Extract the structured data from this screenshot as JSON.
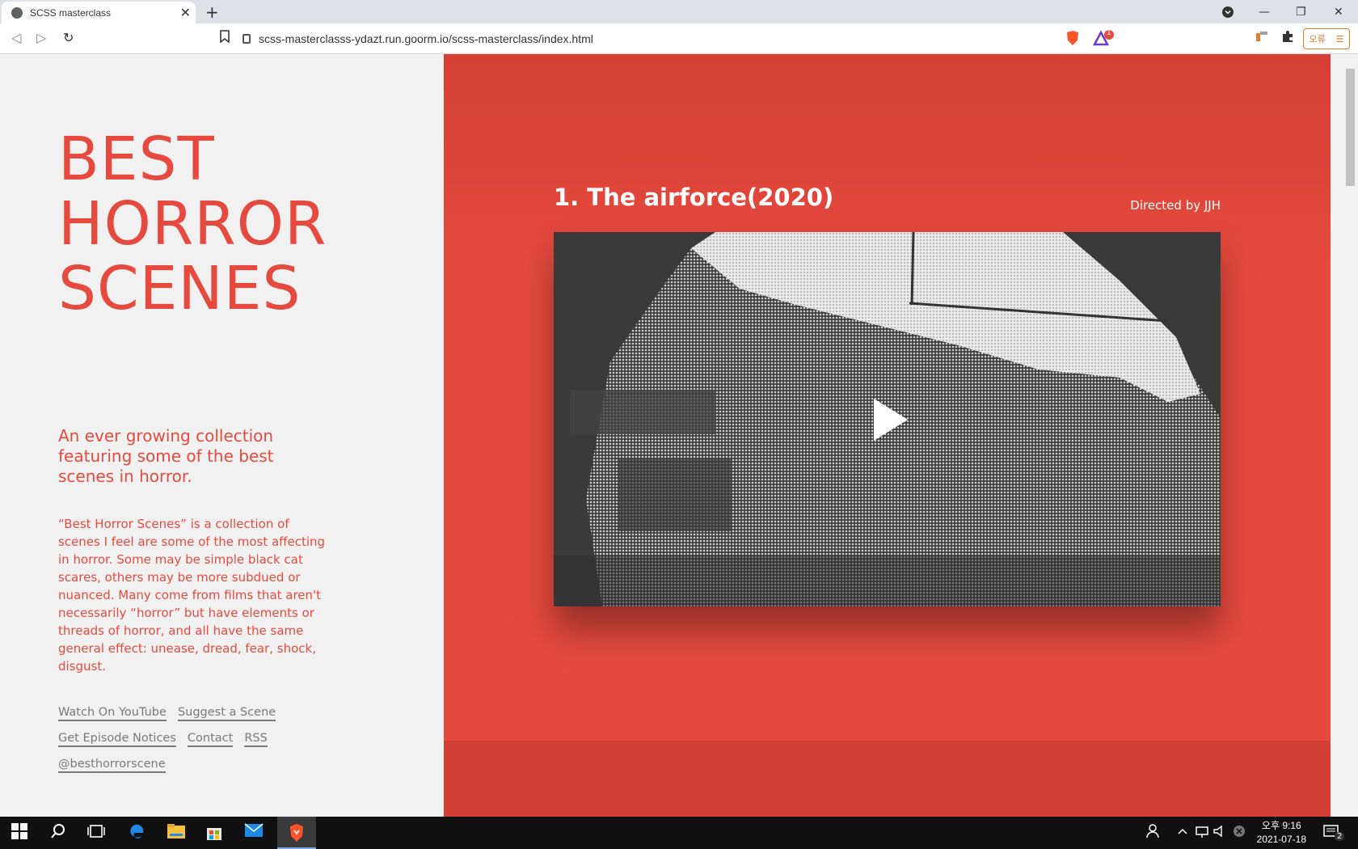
{
  "browser": {
    "tab_title": "SCSS masterclass",
    "tab_close": "✕",
    "new_tab": "+",
    "url": "scss-masterclasss-ydazt.run.goorm.io/scss-masterclass/index.html",
    "error_button_label": "오류",
    "menu_glyph": "☰",
    "back_glyph": "◁",
    "forward_glyph": "▷",
    "reload_glyph": "↻",
    "minimize_glyph": "—",
    "restore_glyph": "❐",
    "close_glyph": "✕",
    "alert_badge": "1",
    "colors": {
      "brave": "#fb542b",
      "error": "#e57c2b"
    }
  },
  "page": {
    "title_lines": [
      "BEST",
      "HORROR",
      "SCENES"
    ],
    "tagline": "An ever growing collection featuring some of the best scenes in horror.",
    "description": "“Best Horror Scenes” is a collection of scenes I feel are some of the most affecting in horror. Some may be simple black cat scares, others may be more subdued or nuanced. Many come from films that aren't necessarily “horror” but have elements or threads of horror, and all have the same general effect: unease, dread, fear, shock, disgust.",
    "links": [
      "Watch On YouTube",
      "Suggest a Scene",
      "Get Episode Notices",
      "Contact",
      "RSS",
      "@besthorrorscene"
    ],
    "film": {
      "title": "1. The airforce(2020)",
      "director": "Directed by JJH"
    },
    "colors": {
      "accent": "#e64a3e",
      "link": "#7a7a7a"
    }
  },
  "taskbar": {
    "time": "오후 9:16",
    "date": "2021-07-18",
    "notification_count": "2"
  }
}
